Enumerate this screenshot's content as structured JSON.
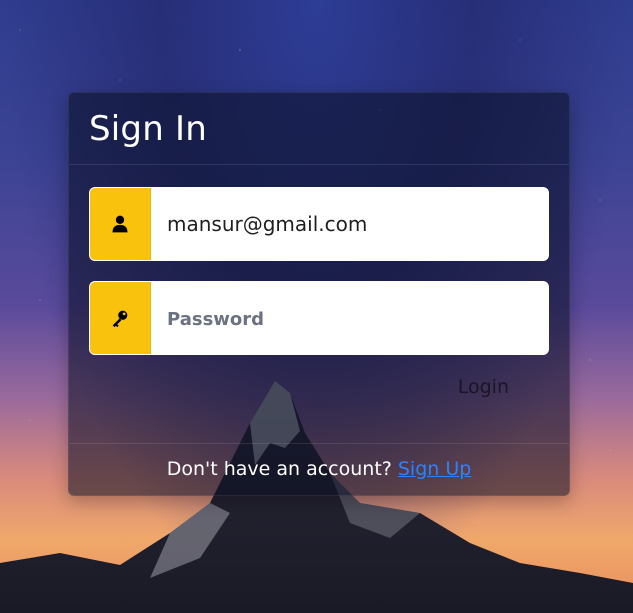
{
  "form": {
    "title": "Sign In",
    "email_value": "mansur@gmail.com",
    "password_placeholder": "Password",
    "login_label": "Login"
  },
  "footer": {
    "prompt": "Don't have an account?",
    "signup_label": "Sign Up"
  },
  "icons": {
    "email_prefix": "user-icon",
    "password_prefix": "key-icon"
  },
  "colors": {
    "accent_yellow": "#f9c20d",
    "link_blue": "#2f80ff",
    "card_bg": "rgba(10,15,35,0.55)"
  }
}
